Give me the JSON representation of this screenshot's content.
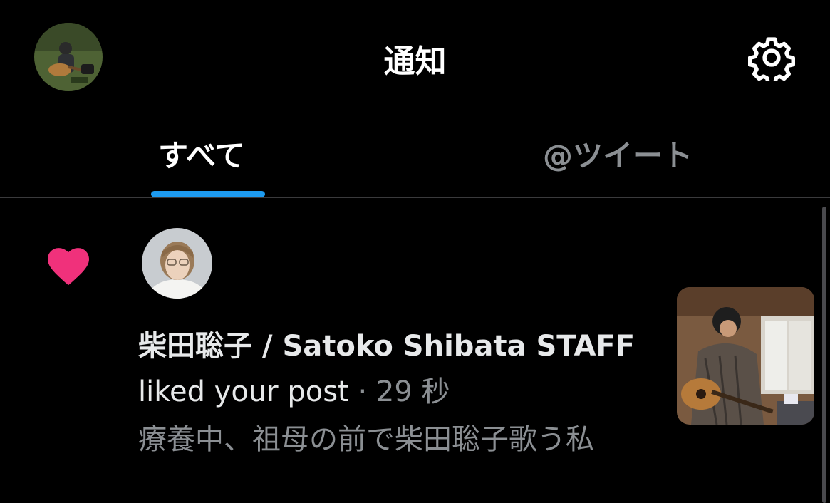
{
  "header": {
    "title": "通知",
    "avatar_icon": "user-avatar-icon",
    "settings_icon": "gear-icon"
  },
  "tabs": [
    {
      "label": "すべて",
      "active": true
    },
    {
      "label": "@ツイート",
      "active": false
    }
  ],
  "notification": {
    "type_icon": "heart-icon",
    "actor_name": "柴田聡子 / Satoko Shibata STAFF",
    "action": "liked your post",
    "separator": "·",
    "time": "29 秒",
    "post_text": "療養中、祖母の前で柴田聡子歌う私"
  },
  "colors": {
    "background": "#000000",
    "accent": "#1d9bf0",
    "like": "#f0317b",
    "text_primary": "#e7e9ea",
    "text_secondary": "#8b8f93",
    "divider": "#3a3a3c"
  }
}
